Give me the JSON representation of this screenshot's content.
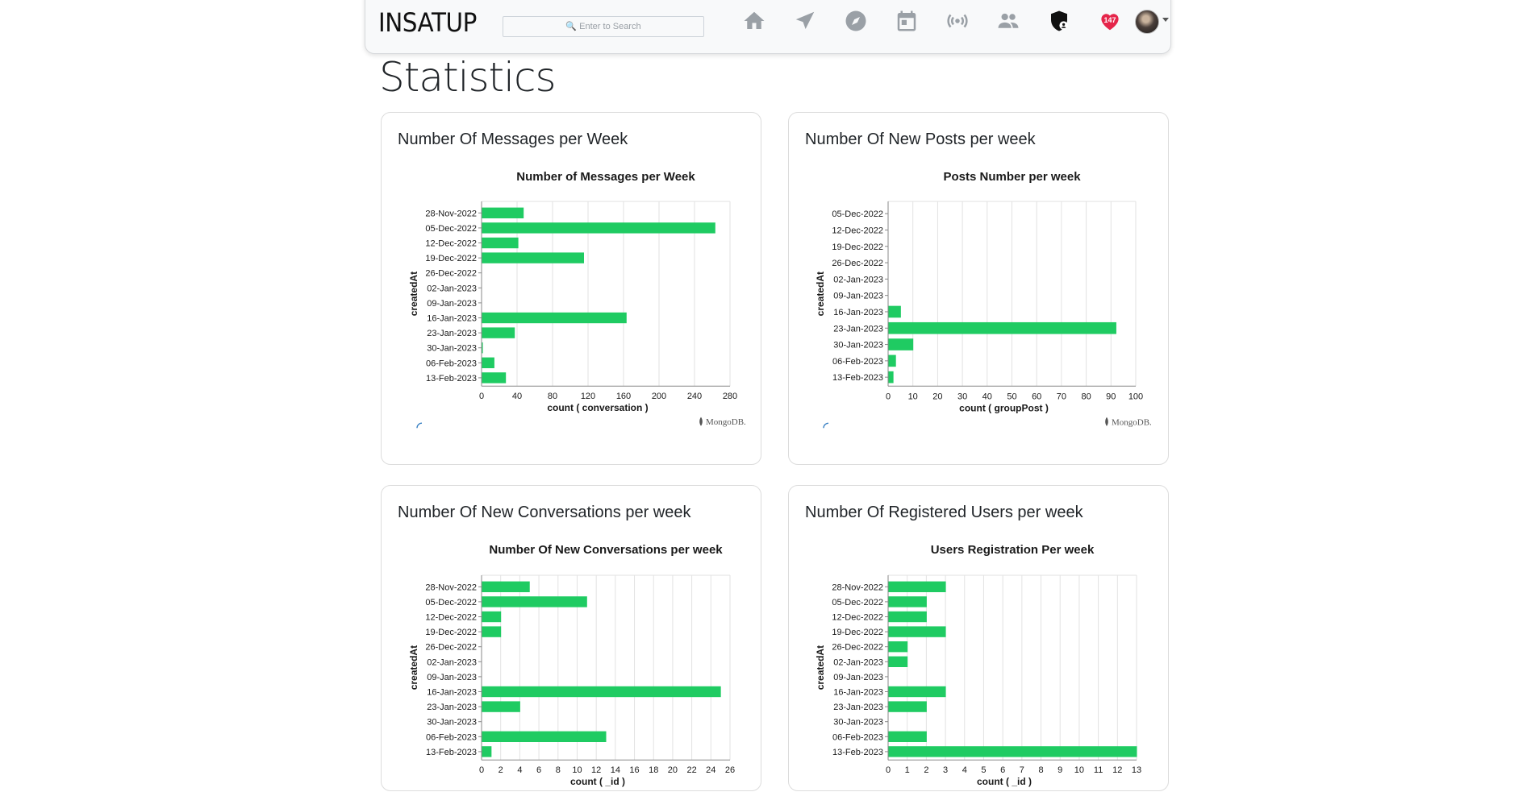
{
  "navbar": {
    "brand": "INSATUP",
    "search_placeholder": "🔍 Enter to Search",
    "notification_count": "147",
    "icons": [
      "home-icon",
      "send-icon",
      "explore-icon",
      "calendar-icon",
      "broadcast-icon",
      "people-icon",
      "admin-shield-icon",
      "heart-icon",
      "avatar",
      "dropdown-caret-icon"
    ]
  },
  "page": {
    "title": "Statistics"
  },
  "colors": {
    "bar": "#1fcb62",
    "grid": "#e2e2e2",
    "axis": "#888888",
    "text": "#1a1a1a"
  },
  "cards": [
    {
      "title": "Number Of Messages per Week"
    },
    {
      "title": "Number Of New Posts per week"
    },
    {
      "title": "Number Of New Conversations per week"
    },
    {
      "title": "Number Of Registered Users per week"
    }
  ],
  "chart_data": [
    {
      "type": "bar",
      "orientation": "horizontal",
      "title": "Number of Messages per Week",
      "xlabel": "count ( conversation )",
      "ylabel": "createdAt",
      "categories": [
        "28-Nov-2022",
        "05-Dec-2022",
        "12-Dec-2022",
        "19-Dec-2022",
        "26-Dec-2022",
        "02-Jan-2023",
        "09-Jan-2023",
        "16-Jan-2023",
        "23-Jan-2023",
        "30-Jan-2023",
        "06-Feb-2023",
        "13-Feb-2023"
      ],
      "values": [
        47,
        263,
        41,
        115,
        0,
        0,
        0,
        163,
        37,
        1,
        14,
        27
      ],
      "xlim": [
        0,
        280
      ],
      "xticks": [
        "0",
        "40",
        "80",
        "120",
        "160",
        "200",
        "240",
        "280"
      ],
      "footer": "MongoDB."
    },
    {
      "type": "bar",
      "orientation": "horizontal",
      "title": "Posts Number per week",
      "xlabel": "count ( groupPost )",
      "ylabel": "createdAt",
      "categories": [
        "05-Dec-2022",
        "12-Dec-2022",
        "19-Dec-2022",
        "26-Dec-2022",
        "02-Jan-2023",
        "09-Jan-2023",
        "16-Jan-2023",
        "23-Jan-2023",
        "30-Jan-2023",
        "06-Feb-2023",
        "13-Feb-2023"
      ],
      "values": [
        0,
        0,
        0,
        0,
        0,
        0,
        5,
        92,
        10,
        3,
        2
      ],
      "xlim": [
        0,
        100
      ],
      "xticks": [
        "0",
        "10",
        "20",
        "30",
        "40",
        "50",
        "60",
        "70",
        "80",
        "90",
        "100"
      ],
      "footer": "MongoDB."
    },
    {
      "type": "bar",
      "orientation": "horizontal",
      "title": "Number Of New Conversations per week",
      "xlabel": "count ( _id )",
      "ylabel": "createdAt",
      "categories": [
        "28-Nov-2022",
        "05-Dec-2022",
        "12-Dec-2022",
        "19-Dec-2022",
        "26-Dec-2022",
        "02-Jan-2023",
        "09-Jan-2023",
        "16-Jan-2023",
        "23-Jan-2023",
        "30-Jan-2023",
        "06-Feb-2023",
        "13-Feb-2023"
      ],
      "values": [
        5,
        11,
        2,
        2,
        0,
        0,
        0,
        25,
        4,
        0,
        13,
        1
      ],
      "xlim": [
        0,
        26
      ],
      "xticks": [
        "0",
        "2",
        "4",
        "6",
        "8",
        "10",
        "12",
        "14",
        "16",
        "18",
        "20",
        "22",
        "24",
        "26"
      ],
      "footer": ""
    },
    {
      "type": "bar",
      "orientation": "horizontal",
      "title": "Users Registration Per week",
      "xlabel": "count ( _id )",
      "ylabel": "createdAt",
      "categories": [
        "28-Nov-2022",
        "05-Dec-2022",
        "12-Dec-2022",
        "19-Dec-2022",
        "26-Dec-2022",
        "02-Jan-2023",
        "09-Jan-2023",
        "16-Jan-2023",
        "23-Jan-2023",
        "30-Jan-2023",
        "06-Feb-2023",
        "13-Feb-2023"
      ],
      "values": [
        3,
        2,
        2,
        3,
        1,
        1,
        0,
        3,
        2,
        0,
        2,
        13
      ],
      "xlim": [
        0,
        13
      ],
      "xticks": [
        "0",
        "1",
        "2",
        "3",
        "4",
        "5",
        "6",
        "7",
        "8",
        "9",
        "10",
        "11",
        "12",
        "13"
      ],
      "footer": ""
    }
  ]
}
